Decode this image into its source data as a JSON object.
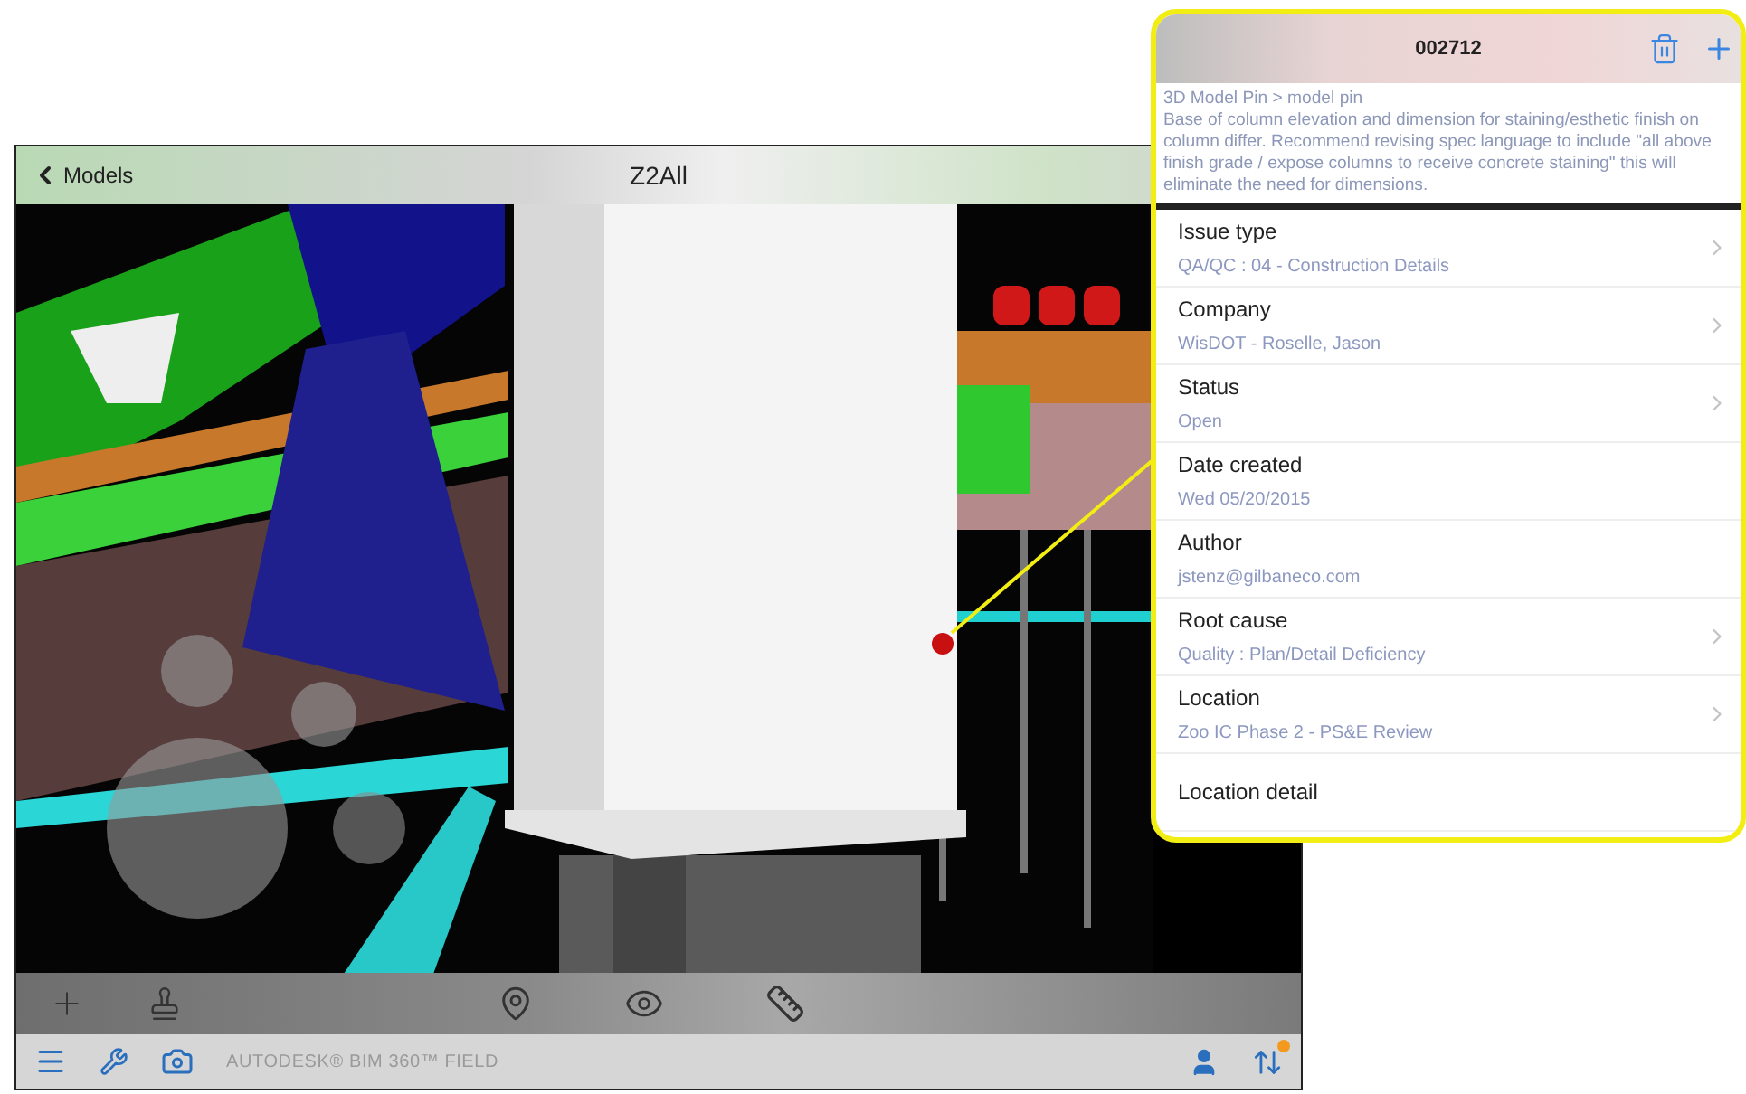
{
  "viewer": {
    "back_label": "Models",
    "title": "Z2All"
  },
  "footer": {
    "brand": "AUTODESK® BIM 360™ FIELD",
    "notification": true
  },
  "callout": {
    "title": "002712",
    "breadcrumb": "3D Model Pin > model pin",
    "description": "Base of column elevation and dimension for staining/esthetic finish on column differ.  Recommend revising spec language to include \"all above finish grade / expose columns to receive concrete staining\" this will eliminate the need for dimensions.",
    "fields": [
      {
        "label": "Issue type",
        "value": "QA/QC : 04 - Construction Details",
        "disclosure": true
      },
      {
        "label": "Company",
        "value": "WisDOT - Roselle, Jason",
        "disclosure": true
      },
      {
        "label": "Status",
        "value": "Open",
        "disclosure": true
      },
      {
        "label": "Date created",
        "value": "Wed 05/20/2015",
        "disclosure": false
      },
      {
        "label": "Author",
        "value": "jstenz@gilbaneco.com",
        "disclosure": false
      },
      {
        "label": "Root cause",
        "value": "Quality : Plan/Detail Deficiency",
        "disclosure": true
      },
      {
        "label": "Location",
        "value": "Zoo IC Phase 2 - PS&E Review",
        "disclosure": true
      },
      {
        "label": "Location detail",
        "disclosure": false
      }
    ]
  }
}
